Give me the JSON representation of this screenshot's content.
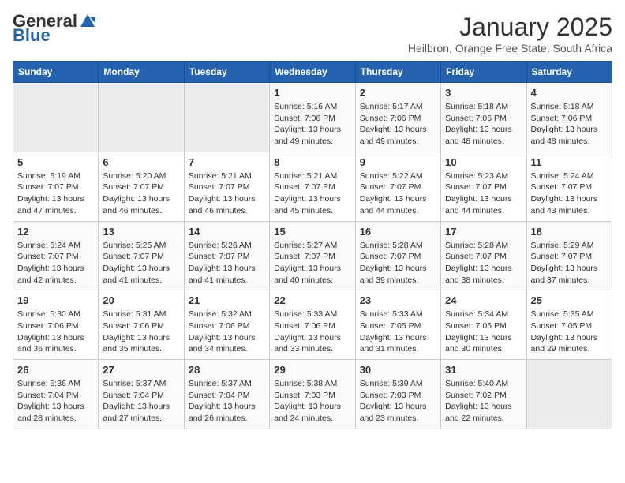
{
  "logo": {
    "general": "General",
    "blue": "Blue"
  },
  "title": "January 2025",
  "subtitle": "Heilbron, Orange Free State, South Africa",
  "days_of_week": [
    "Sunday",
    "Monday",
    "Tuesday",
    "Wednesday",
    "Thursday",
    "Friday",
    "Saturday"
  ],
  "weeks": [
    [
      {
        "day": "",
        "info": ""
      },
      {
        "day": "",
        "info": ""
      },
      {
        "day": "",
        "info": ""
      },
      {
        "day": "1",
        "info": "Sunrise: 5:16 AM\nSunset: 7:06 PM\nDaylight: 13 hours and 49 minutes."
      },
      {
        "day": "2",
        "info": "Sunrise: 5:17 AM\nSunset: 7:06 PM\nDaylight: 13 hours and 49 minutes."
      },
      {
        "day": "3",
        "info": "Sunrise: 5:18 AM\nSunset: 7:06 PM\nDaylight: 13 hours and 48 minutes."
      },
      {
        "day": "4",
        "info": "Sunrise: 5:18 AM\nSunset: 7:06 PM\nDaylight: 13 hours and 48 minutes."
      }
    ],
    [
      {
        "day": "5",
        "info": "Sunrise: 5:19 AM\nSunset: 7:07 PM\nDaylight: 13 hours and 47 minutes."
      },
      {
        "day": "6",
        "info": "Sunrise: 5:20 AM\nSunset: 7:07 PM\nDaylight: 13 hours and 46 minutes."
      },
      {
        "day": "7",
        "info": "Sunrise: 5:21 AM\nSunset: 7:07 PM\nDaylight: 13 hours and 46 minutes."
      },
      {
        "day": "8",
        "info": "Sunrise: 5:21 AM\nSunset: 7:07 PM\nDaylight: 13 hours and 45 minutes."
      },
      {
        "day": "9",
        "info": "Sunrise: 5:22 AM\nSunset: 7:07 PM\nDaylight: 13 hours and 44 minutes."
      },
      {
        "day": "10",
        "info": "Sunrise: 5:23 AM\nSunset: 7:07 PM\nDaylight: 13 hours and 44 minutes."
      },
      {
        "day": "11",
        "info": "Sunrise: 5:24 AM\nSunset: 7:07 PM\nDaylight: 13 hours and 43 minutes."
      }
    ],
    [
      {
        "day": "12",
        "info": "Sunrise: 5:24 AM\nSunset: 7:07 PM\nDaylight: 13 hours and 42 minutes."
      },
      {
        "day": "13",
        "info": "Sunrise: 5:25 AM\nSunset: 7:07 PM\nDaylight: 13 hours and 41 minutes."
      },
      {
        "day": "14",
        "info": "Sunrise: 5:26 AM\nSunset: 7:07 PM\nDaylight: 13 hours and 41 minutes."
      },
      {
        "day": "15",
        "info": "Sunrise: 5:27 AM\nSunset: 7:07 PM\nDaylight: 13 hours and 40 minutes."
      },
      {
        "day": "16",
        "info": "Sunrise: 5:28 AM\nSunset: 7:07 PM\nDaylight: 13 hours and 39 minutes."
      },
      {
        "day": "17",
        "info": "Sunrise: 5:28 AM\nSunset: 7:07 PM\nDaylight: 13 hours and 38 minutes."
      },
      {
        "day": "18",
        "info": "Sunrise: 5:29 AM\nSunset: 7:07 PM\nDaylight: 13 hours and 37 minutes."
      }
    ],
    [
      {
        "day": "19",
        "info": "Sunrise: 5:30 AM\nSunset: 7:06 PM\nDaylight: 13 hours and 36 minutes."
      },
      {
        "day": "20",
        "info": "Sunrise: 5:31 AM\nSunset: 7:06 PM\nDaylight: 13 hours and 35 minutes."
      },
      {
        "day": "21",
        "info": "Sunrise: 5:32 AM\nSunset: 7:06 PM\nDaylight: 13 hours and 34 minutes."
      },
      {
        "day": "22",
        "info": "Sunrise: 5:33 AM\nSunset: 7:06 PM\nDaylight: 13 hours and 33 minutes."
      },
      {
        "day": "23",
        "info": "Sunrise: 5:33 AM\nSunset: 7:05 PM\nDaylight: 13 hours and 31 minutes."
      },
      {
        "day": "24",
        "info": "Sunrise: 5:34 AM\nSunset: 7:05 PM\nDaylight: 13 hours and 30 minutes."
      },
      {
        "day": "25",
        "info": "Sunrise: 5:35 AM\nSunset: 7:05 PM\nDaylight: 13 hours and 29 minutes."
      }
    ],
    [
      {
        "day": "26",
        "info": "Sunrise: 5:36 AM\nSunset: 7:04 PM\nDaylight: 13 hours and 28 minutes."
      },
      {
        "day": "27",
        "info": "Sunrise: 5:37 AM\nSunset: 7:04 PM\nDaylight: 13 hours and 27 minutes."
      },
      {
        "day": "28",
        "info": "Sunrise: 5:37 AM\nSunset: 7:04 PM\nDaylight: 13 hours and 26 minutes."
      },
      {
        "day": "29",
        "info": "Sunrise: 5:38 AM\nSunset: 7:03 PM\nDaylight: 13 hours and 24 minutes."
      },
      {
        "day": "30",
        "info": "Sunrise: 5:39 AM\nSunset: 7:03 PM\nDaylight: 13 hours and 23 minutes."
      },
      {
        "day": "31",
        "info": "Sunrise: 5:40 AM\nSunset: 7:02 PM\nDaylight: 13 hours and 22 minutes."
      },
      {
        "day": "",
        "info": ""
      }
    ]
  ]
}
